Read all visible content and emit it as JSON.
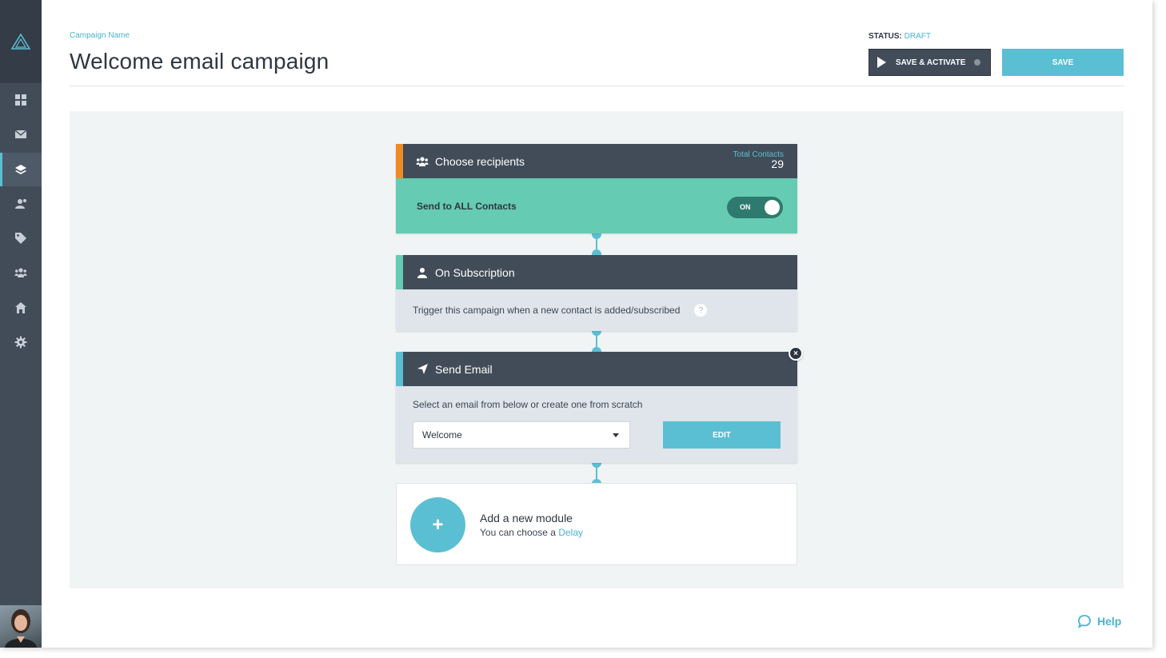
{
  "header": {
    "campaign_label": "Campaign Name",
    "title": "Welcome email campaign",
    "status_label": "STATUS:",
    "status_value": "DRAFT",
    "save_activate_label": "SAVE & ACTIVATE",
    "save_label": "SAVE"
  },
  "sidebar": {
    "items": [
      {
        "icon": "dashboard-grid-icon",
        "active": false
      },
      {
        "icon": "envelope-icon",
        "active": false
      },
      {
        "icon": "layers-icon",
        "active": true
      },
      {
        "icon": "contacts-icon",
        "active": false
      },
      {
        "icon": "tag-icon",
        "active": false
      },
      {
        "icon": "group-icon",
        "active": false
      },
      {
        "icon": "home-icon",
        "active": false
      },
      {
        "icon": "gear-icon",
        "active": false
      }
    ]
  },
  "modules": {
    "recipients": {
      "title": "Choose recipients",
      "total_label": "Total Contacts",
      "total_value": "29",
      "body_text": "Send to ALL Contacts",
      "toggle_label": "ON",
      "accent": "#f08a24"
    },
    "trigger": {
      "title": "On Subscription",
      "body_text": "Trigger this campaign when a new contact is added/subscribed",
      "help_mark": "?",
      "accent": "#66cbb3"
    },
    "send_email": {
      "title": "Send Email",
      "hint": "Select an email from below or create one from scratch",
      "selected_email": "Welcome",
      "edit_label": "EDIT",
      "close_label": "×",
      "accent": "#5bbfd4"
    },
    "add": {
      "plus": "+",
      "title": "Add a new module",
      "subtitle_prefix": "You can choose a",
      "subtitle_link": "Delay"
    }
  },
  "help": {
    "label": "Help"
  },
  "colors": {
    "sidebar": "#424c59",
    "accent_blue": "#5bbfd4",
    "green": "#66cbb3",
    "dark": "#2e3642"
  }
}
